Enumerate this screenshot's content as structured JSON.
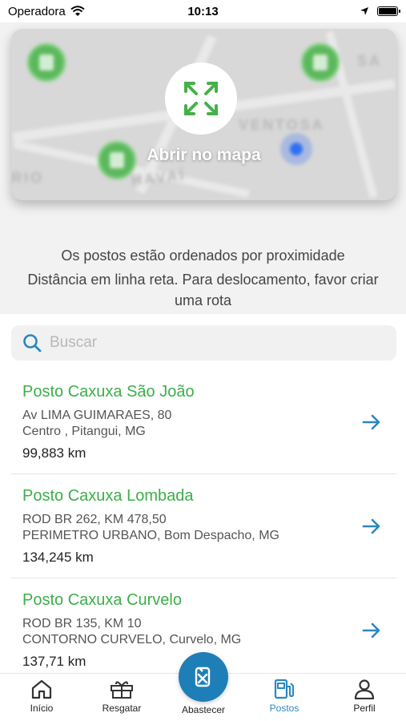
{
  "status_bar": {
    "carrier": "Operadora",
    "time": "10:13"
  },
  "map": {
    "open_label": "Abrir no mapa",
    "street_labels": [
      "VENTOSA",
      "HAVAÍ",
      "RIO",
      "SA"
    ]
  },
  "info": {
    "line1": "Os postos estão ordenados por proximidade",
    "line2": "Distância em linha reta. Para deslocamento, favor criar",
    "line3": "uma rota"
  },
  "search": {
    "placeholder": "Buscar"
  },
  "stations": [
    {
      "name": "Posto Caxuxa São João",
      "address1": "Av LIMA GUIMARAES, 80",
      "address2": "Centro , Pitangui, MG",
      "distance": "99,883 km"
    },
    {
      "name": "Posto Caxuxa Lombada",
      "address1": "ROD BR 262, KM 478,50",
      "address2": "PERIMETRO URBANO, Bom Despacho, MG",
      "distance": "134,245 km"
    },
    {
      "name": "Posto Caxuxa Curvelo",
      "address1": "ROD BR 135, KM 10",
      "address2": "CONTORNO CURVELO, Curvelo, MG",
      "distance": "137,71 km"
    }
  ],
  "tabs": {
    "inicio": "Início",
    "resgatar": "Resgatar",
    "abastecer": "Abastecer",
    "postos": "Postos",
    "perfil": "Perfil"
  },
  "colors": {
    "accent_blue": "#2a87c1",
    "station_green": "#3cae4a",
    "fab_blue": "#1e7fb8"
  },
  "icons": [
    "wifi-icon",
    "location-arrow-icon",
    "battery-icon",
    "expand-icon",
    "search-icon",
    "arrow-right-icon",
    "home-icon",
    "gift-icon",
    "fuel-pump-icon",
    "station-icon",
    "user-icon"
  ]
}
